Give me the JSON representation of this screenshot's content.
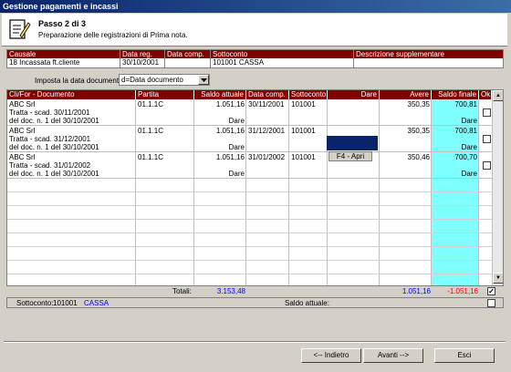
{
  "window": {
    "title": "Gestione pagamenti e incassi"
  },
  "header": {
    "step": "Passo 2 di 3",
    "description": "Preparazione delle registrazioni di Prima nota."
  },
  "causale_grid": {
    "headers": [
      "Causale",
      "Data reg.",
      "Data comp.",
      "Sottoconto",
      "Descrizione supplementare"
    ],
    "values": [
      "18 Incassata ft.cliente",
      "30/10/2001",
      "",
      "101001 CASSA",
      ""
    ]
  },
  "date_import": {
    "label": "Imposta la data documento:",
    "selected": "d=Data documento"
  },
  "grid": {
    "headers": [
      "Cli/For - Documento",
      "Partita",
      "Saldo attuale",
      "Data comp.",
      "Sottoconto",
      "Dare",
      "Avere",
      "Saldo finale",
      "Ok"
    ],
    "rows": [
      {
        "doc1": "ABC Srl",
        "doc2": "Tratta - scad. 30/11/2001",
        "doc3": "del doc. n. 1 del 30/10/2001",
        "partita": "01.1.1C",
        "saldo": "1.051,16",
        "saldo_seg": "Dare",
        "data_comp": "30/11/2001",
        "sottoconto": "101001",
        "dare": "",
        "avere": "350,35",
        "saldo_fin": "700,81",
        "saldo_fin_seg": "Dare"
      },
      {
        "doc1": "ABC Srl",
        "doc2": "Tratta - scad. 31/12/2001",
        "doc3": "del doc. n. 1 del 30/10/2001",
        "partita": "01.1.1C",
        "saldo": "1.051,16",
        "saldo_seg": "Dare",
        "data_comp": "31/12/2001",
        "sottoconto": "101001",
        "dare": "",
        "avere": "350,35",
        "saldo_fin": "700,81",
        "saldo_fin_seg": "Dare"
      },
      {
        "doc1": "ABC Srl",
        "doc2": "Tratta - scad. 31/01/2002",
        "doc3": "del doc. n. 1 del 30/10/2001",
        "partita": "01.1.1C",
        "saldo": "1.051,16",
        "saldo_seg": "Dare",
        "data_comp": "31/01/2002",
        "sottoconto": "101001",
        "dare": "",
        "avere": "350,46",
        "saldo_fin": "700,70",
        "saldo_fin_seg": "Dare"
      }
    ],
    "popup": "F4 - Apri"
  },
  "totals": {
    "label": "Totali:",
    "saldo": "3.153,48",
    "avere": "1.051,16",
    "saldo_fin": "-1.051,16"
  },
  "sottoconto_row": {
    "label": "Sottoconto:",
    "code": "101001",
    "name": "CASSA",
    "saldo_label": "Saldo attuale:"
  },
  "buttons": {
    "back": "<-- Indietro",
    "next": "Avanti -->",
    "exit": "Esci"
  },
  "colors": {
    "header_bg": "#800000",
    "saldo_bg": "#7fffff",
    "negative": "#ff0000",
    "blue": "#0000ff"
  }
}
